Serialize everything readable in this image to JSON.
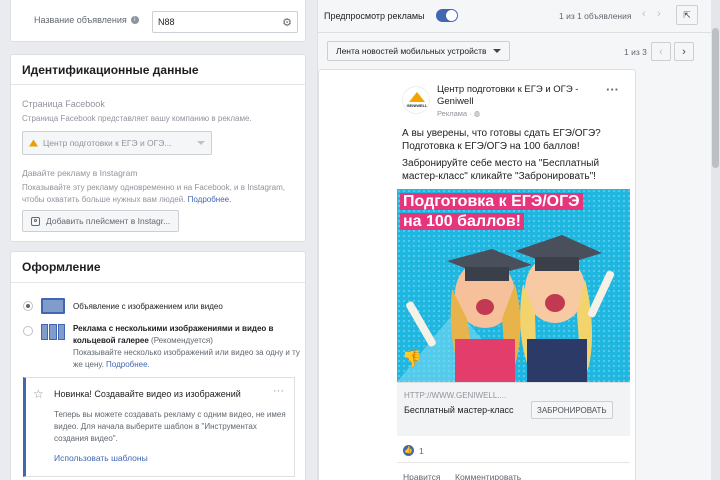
{
  "ad_name": {
    "label": "Название объявления",
    "value": "N88"
  },
  "identity": {
    "title": "Идентификационные данные",
    "fb_page_label": "Страница Facebook",
    "fb_page_desc": "Страница Facebook представляет вашу компанию в рекламе.",
    "fb_page_value": "Центр подготовки к ЕГЭ и ОГЭ...",
    "ig_label": "Давайте рекламу в Instagram",
    "ig_desc": "Показывайте эту рекламу одновременно и на Facebook, и в Instagram, чтобы охватить больше нужных вам людей.",
    "ig_more": "Подробнее.",
    "ig_button": "Добавить плейсмент в Instagr..."
  },
  "design": {
    "title": "Оформление",
    "option1": "Объявление с изображением или видео",
    "option2_title": "Реклама с несколькими изображениями и видео в кольцевой галерее",
    "option2_note": "(Рекомендуется)",
    "option2_desc": "Показывайте несколько изображений или видео за одну и ту же цену.",
    "option2_more": "Подробнее.",
    "new_title": "Новинка! Создавайте видео из изображений",
    "new_desc": "Теперь вы можете создавать рекламу с одним видео, не имея видео. Для начала выберите шаблон в \"Инструментах создания видео\".",
    "new_link": "Использовать шаблоны"
  },
  "preview": {
    "toggle_label": "Предпросмотр рекламы",
    "ad_counter": "1 из 1 объявления",
    "placement": "Лента новостей мобильных устройств",
    "placement_counter": "1 из 3"
  },
  "post": {
    "page_name": "Центр подготовки к ЕГЭ и ОГЭ - Geniwell",
    "sponsored": "Реклама · ",
    "logo_text": "GENIWELL",
    "text_lines": [
      "А вы уверены, что готовы сдать ЕГЭ/ОГЭ?",
      "Подготовка к ЕГЭ/ОГЭ на 100 баллов!",
      "Забронируйте себе место на \"Бесплатный мастер-класс\" кликайте \"Забронировать\"!"
    ],
    "image_headline": "Подготовка к ЕГЭ/ОГЭ на 100 баллов!",
    "url": "HTTP://WWW.GENIWELL....",
    "cta_title": "Бесплатный мастер-класс",
    "cta_button": "ЗАБРОНИРОВАТЬ",
    "reactions": "1",
    "like": "Нравится",
    "comment": "Комментировать"
  },
  "colors": {
    "accent": "#4267b2",
    "image_bg": "#1fb6e0",
    "headline_bg": "#e6357d"
  }
}
